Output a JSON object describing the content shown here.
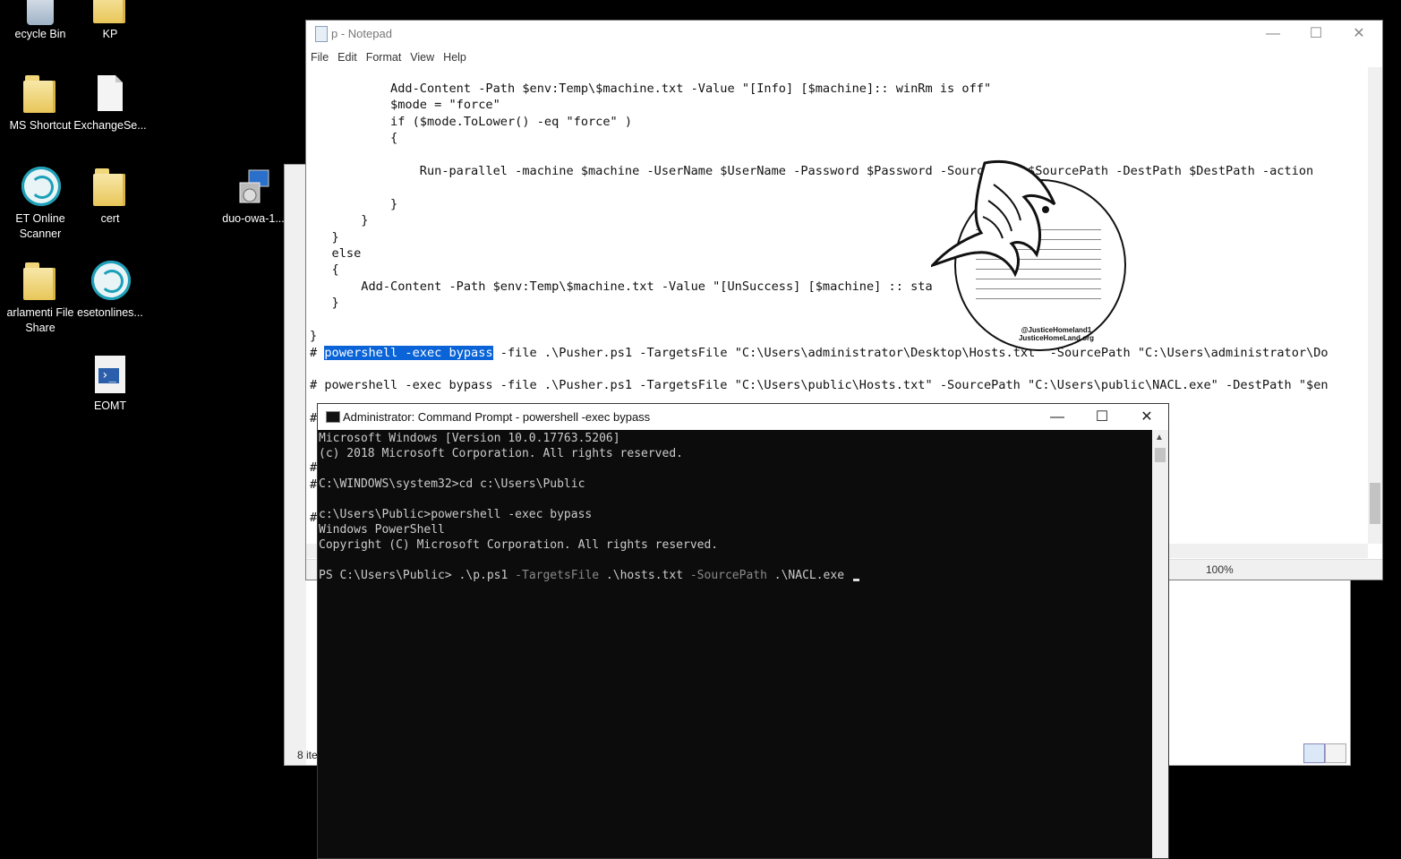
{
  "desktop": {
    "icons": [
      {
        "label": "ecycle Bin",
        "icon": "recycle-bin-icon"
      },
      {
        "label": "KP",
        "icon": "folder-icon"
      },
      {
        "label": "MS Shortcut",
        "icon": "folder-shortcut-icon"
      },
      {
        "label": "ExchangeSe...",
        "icon": "document-icon"
      },
      {
        "label": "ET Online Scanner",
        "icon": "eset-scanner-icon"
      },
      {
        "label": "cert",
        "icon": "folder-icon"
      },
      {
        "label": "duo-owa-1...",
        "icon": "installer-icon"
      },
      {
        "label": "arlamenti File Share",
        "icon": "folder-shortcut-icon"
      },
      {
        "label": "esetonlines...",
        "icon": "eset-scanner-icon"
      },
      {
        "label": "EOMT",
        "icon": "powershell-script-icon"
      }
    ]
  },
  "explorer": {
    "status": "8 ite"
  },
  "notepad": {
    "title": "p - Notepad",
    "menu": [
      "File",
      "Edit",
      "Format",
      "View",
      "Help"
    ],
    "lines": [
      "           Add-Content -Path $env:Temp\\$machine.txt -Value \"[Info] [$machine]:: winRm is off\"",
      "           $mode = \"force\"",
      "           if ($mode.ToLower() -eq \"force\" )",
      "           {",
      "",
      "               Run-parallel -machine $machine -UserName $UserName -Password $Password -SourcePath $SourcePath -DestPath $DestPath -action",
      "",
      "           }",
      "       }",
      "   }",
      "   else",
      "   {",
      "       Add-Content -Path $env:Temp\\$machine.txt -Value \"[UnSuccess] [$machine] :: sta",
      "   }",
      "",
      "}",
      "# |powershell -exec bypass| -file .\\Pusher.ps1 -TargetsFile \"C:\\Users\\administrator\\Desktop\\Hosts.txt\" -SourcePath \"C:\\Users\\administrator\\Do",
      "",
      "# powershell -exec bypass -file .\\Pusher.ps1 -TargetsFile \"C:\\Users\\public\\Hosts.txt\" -SourcePath \"C:\\Users\\public\\NACL.exe\" -DestPath \"$en",
      "",
      "#",
      "",
      "",
      "#",
      "#",
      "",
      "#"
    ],
    "zoom": "100%"
  },
  "watermark": {
    "line1": "@JusticeHomeland1",
    "line2": "JusticeHomeLand.org"
  },
  "cmd": {
    "title": "Administrator: Command Prompt - powershell  -exec bypass",
    "lines": [
      "Microsoft Windows [Version 10.0.17763.5206]",
      "(c) 2018 Microsoft Corporation. All rights reserved.",
      "",
      "C:\\WINDOWS\\system32>cd c:\\Users\\Public",
      "",
      "c:\\Users\\Public>powershell -exec bypass",
      "Windows PowerShell",
      "Copyright (C) Microsoft Corporation. All rights reserved.",
      ""
    ],
    "prompt": {
      "ps": "PS C:\\Users\\Public> ",
      "script": ".\\p.ps1 ",
      "param1": "-TargetsFile ",
      "val1": ".\\hosts.txt ",
      "param2": "-SourcePath ",
      "val2": ".\\NACL.exe "
    }
  },
  "window_controls": {
    "minimize": "—",
    "maximize": "☐",
    "close": "✕"
  }
}
